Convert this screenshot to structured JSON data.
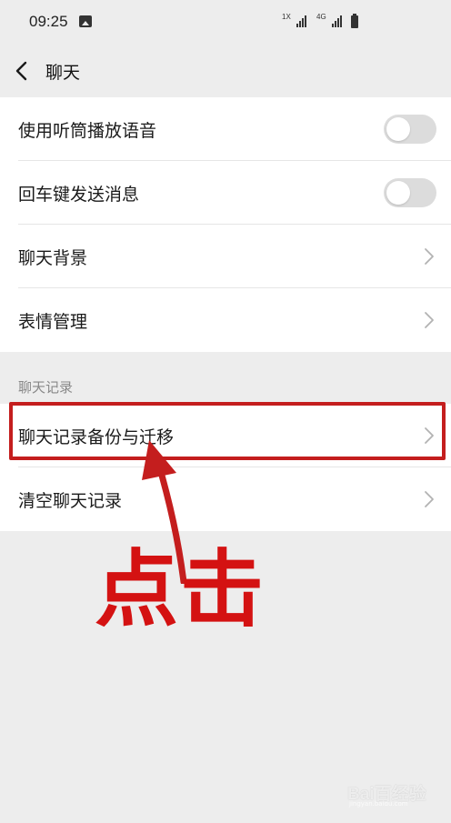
{
  "status_bar": {
    "time": "09:25",
    "sim1_label": "1X",
    "sim2_label": "4G",
    "icons": [
      "gallery-icon",
      "signal-icon",
      "signal-icon",
      "battery-icon"
    ]
  },
  "nav": {
    "title": "聊天",
    "back_icon": "chevron-left-icon"
  },
  "settings_group_1": {
    "items": [
      {
        "label": "使用听筒播放语音",
        "control": "toggle",
        "on": false
      },
      {
        "label": "回车键发送消息",
        "control": "toggle",
        "on": false
      },
      {
        "label": "聊天背景",
        "control": "chevron"
      },
      {
        "label": "表情管理",
        "control": "chevron"
      }
    ]
  },
  "chat_history_section": {
    "header": "聊天记录",
    "items": [
      {
        "label": "聊天记录备份与迁移",
        "control": "chevron",
        "highlighted": true
      },
      {
        "label": "清空聊天记录",
        "control": "chevron"
      }
    ]
  },
  "annotation": {
    "label": "点击",
    "color": "#d41212"
  },
  "watermark": {
    "text": "Bai百经验",
    "url": "jingyan.baidu.com"
  },
  "colors": {
    "background": "#ededed",
    "card": "#ffffff",
    "toggle_off": "#dcdcdc",
    "annotation_red": "#c41e1e"
  }
}
